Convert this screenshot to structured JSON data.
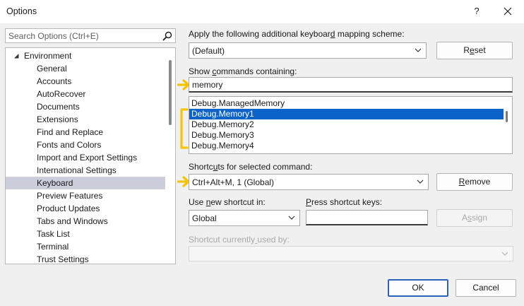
{
  "window": {
    "title": "Options",
    "help_glyph": "?"
  },
  "search": {
    "placeholder": "Search Options (Ctrl+E)"
  },
  "tree": {
    "root_label": "Environment",
    "items": [
      "General",
      "Accounts",
      "AutoRecover",
      "Documents",
      "Extensions",
      "Find and Replace",
      "Fonts and Colors",
      "Import and Export Settings",
      "International Settings",
      "Keyboard",
      "Preview Features",
      "Product Updates",
      "Tabs and Windows",
      "Task List",
      "Terminal",
      "Trust Settings"
    ],
    "selected": "Keyboard"
  },
  "mapping": {
    "label": "Apply the following additional keyboard mapping scheme:",
    "value": "(Default)",
    "reset_label": "Reset"
  },
  "commands": {
    "label": "Show commands containing:",
    "filter_value": "memory",
    "items": [
      "Debug.ManagedMemory",
      "Debug.Memory1",
      "Debug.Memory2",
      "Debug.Memory3",
      "Debug.Memory4"
    ],
    "selected": "Debug.Memory1"
  },
  "shortcuts": {
    "label": "Shortcuts for selected command:",
    "value": "Ctrl+Alt+M, 1 (Global)",
    "remove_label": "Remove"
  },
  "new_shortcut": {
    "use_in_label": "Use new shortcut in:",
    "use_in_value": "Global",
    "press_keys_label": "Press shortcut keys:",
    "press_keys_value": "",
    "assign_label": "Assign"
  },
  "used_by": {
    "label": "Shortcut currently used by:"
  },
  "footer": {
    "ok_label": "OK",
    "cancel_label": "Cancel"
  },
  "colors": {
    "tree_selected_bg": "#cccedb",
    "list_selected_bg": "#0b63c9",
    "annotation_arrow": "#f5c400",
    "primary_border": "#2a63b8"
  }
}
